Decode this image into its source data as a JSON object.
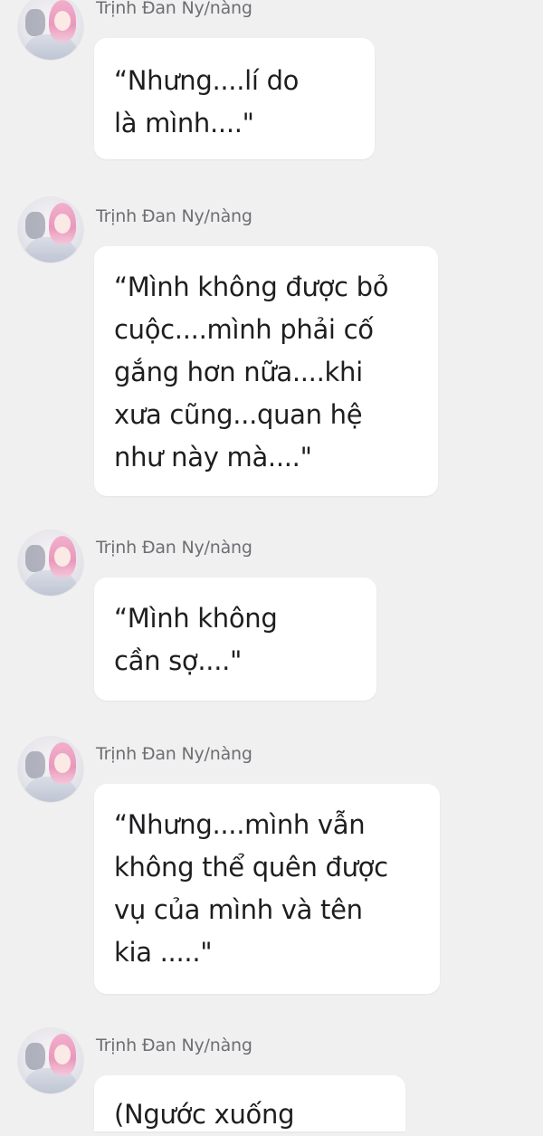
{
  "conversation": {
    "messages": [
      {
        "sender": "Trịnh Đan Ny/nàng",
        "text": "“Nhưng....lí do\nlà mình....\""
      },
      {
        "sender": "Trịnh Đan Ny/nàng",
        "text": "“Mình không được bỏ\ncuộc....mình phải cố\ngắng hơn nữa....khi\nxưa cũng...quan hệ\nnhư này mà....\""
      },
      {
        "sender": "Trịnh Đan Ny/nàng",
        "text": "“Mình không\ncần sợ....\""
      },
      {
        "sender": "Trịnh Đan Ny/nàng",
        "text": "“Nhưng....mình vẫn\nkhông thể quên được\nvụ của mình và tên\nkia .....\""
      },
      {
        "sender": "Trịnh Đan Ny/nàng",
        "text": "(Ngước xuống"
      }
    ],
    "avatar_icon": "profile-photo-pink-hair"
  }
}
